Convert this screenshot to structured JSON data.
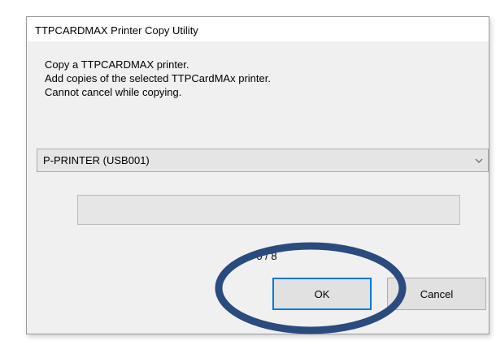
{
  "dialog": {
    "title": "TTPCARDMAX Printer Copy Utility",
    "message_lines": [
      "Copy a TTPCARDMAX printer.",
      "Add copies of the selected TTPCardMAx printer.",
      "Cannot cancel while copying."
    ],
    "printer_select": {
      "selected_value": "P-PRINTER (USB001)",
      "icon": "chevron-down-icon"
    },
    "progress": {
      "fraction": 0,
      "fill_color": "#06b025"
    },
    "counter_text": "0 / 8",
    "buttons": {
      "ok_label": "OK",
      "cancel_label": "Cancel"
    }
  },
  "annotation": {
    "ring_color": "#2b4a7e",
    "target": "ok-button"
  },
  "colors": {
    "dialog_background": "#f0f0f0",
    "focus_border": "#0078d7"
  }
}
